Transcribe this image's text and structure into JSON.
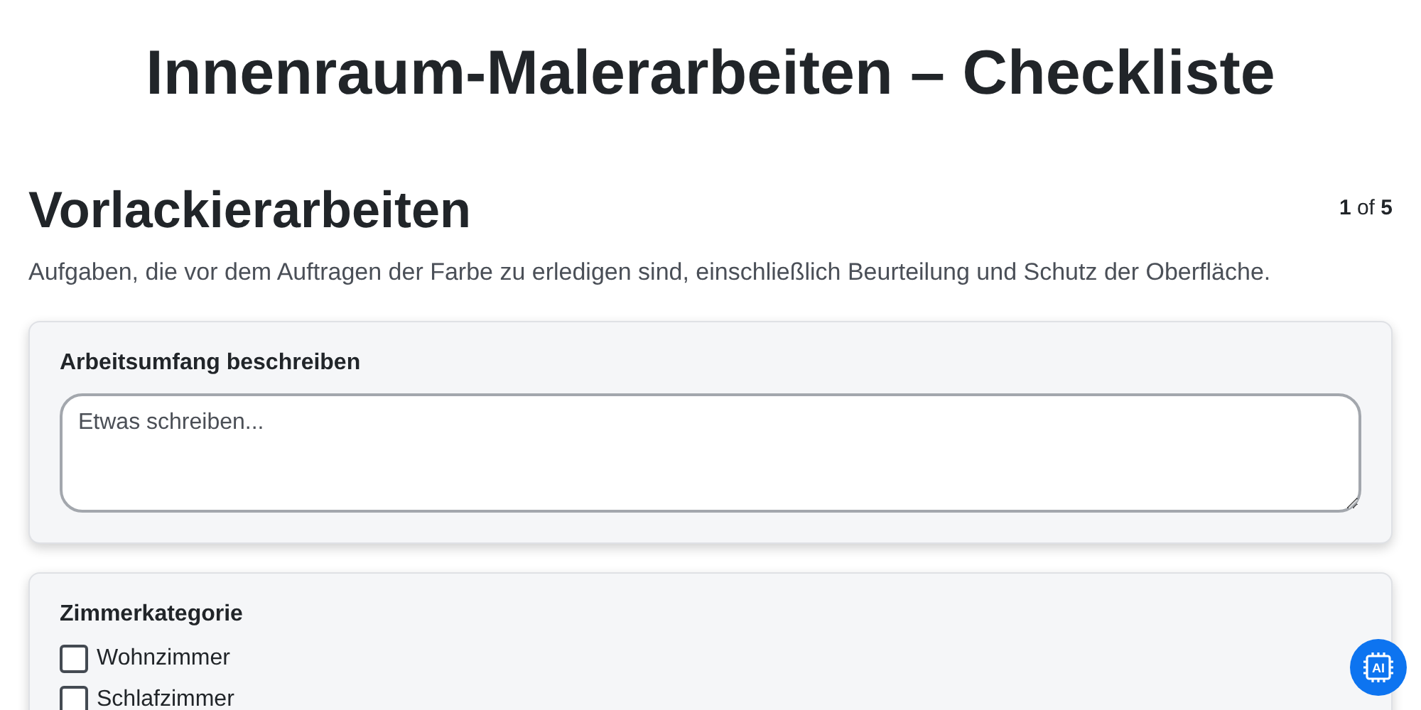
{
  "title": "Innenraum-Malerarbeiten – Checkliste",
  "section": {
    "heading": "Vorlackierarbeiten",
    "counter": "**1** of **5**",
    "description": "Aufgaben, die vor dem Auftragen der Farbe zu erledigen sind, einschließlich Beurteilung und Schutz der Oberfläche."
  },
  "cards": [
    {
      "kind": "text",
      "label": "Arbeitsumfang beschreiben",
      "placeholder": "Etwas schreiben..."
    },
    {
      "kind": "checkboxes",
      "label": "Zimmerkategorie",
      "options": [
        {
          "label": "Wohnzimmer",
          "checked": false
        },
        {
          "label": "Schlafzimmer",
          "checked": false
        }
      ]
    }
  ],
  "ai_button": {
    "label": "AI"
  }
}
